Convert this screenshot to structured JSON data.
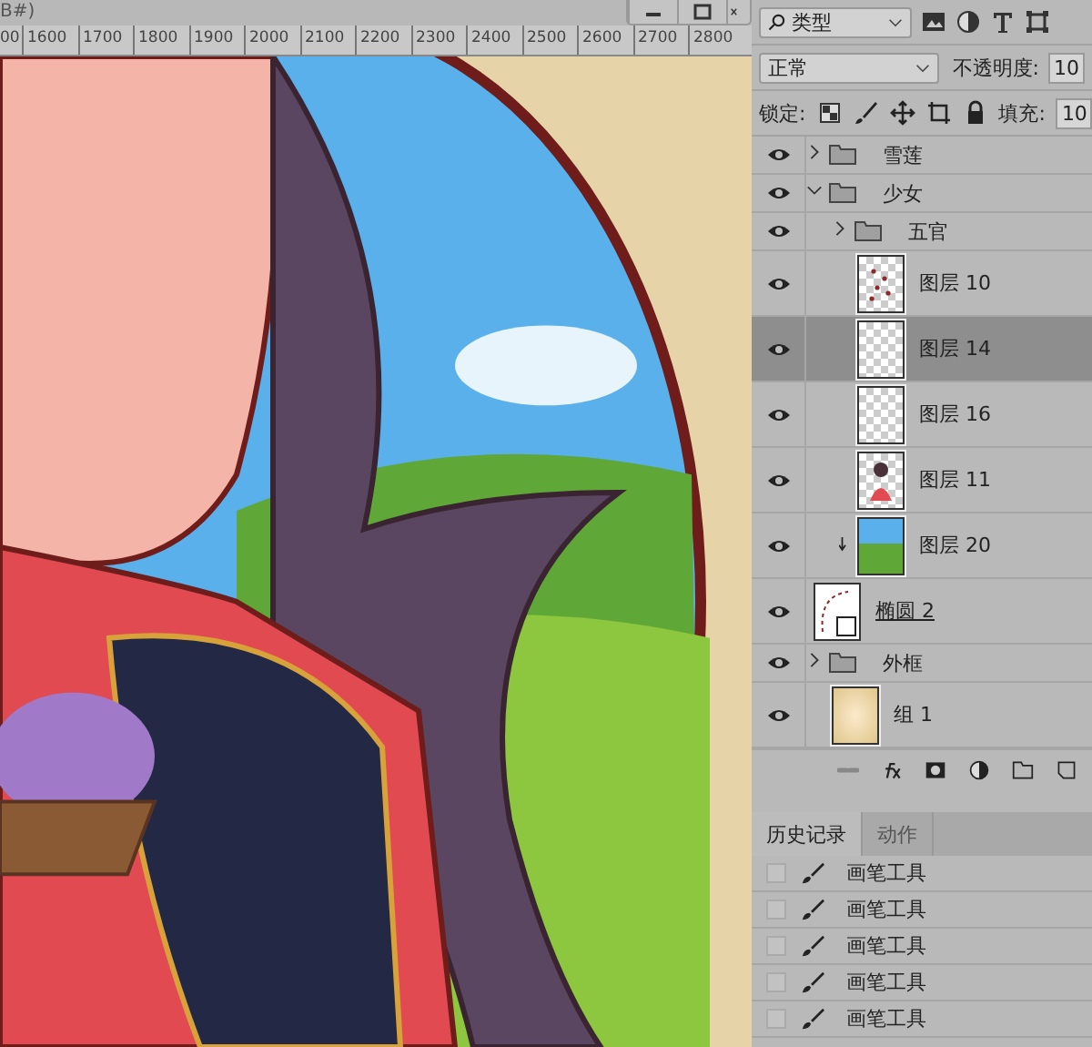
{
  "document": {
    "title_fragment": "B#)",
    "ruler_labels": [
      "00",
      "1600",
      "1700",
      "1800",
      "1900",
      "2000",
      "2100",
      "2200",
      "2300",
      "2400",
      "2500",
      "2600",
      "2700",
      "2800"
    ]
  },
  "layers_panel": {
    "filter": "类型",
    "blend_mode": "正常",
    "opacity_label": "不透明度:",
    "opacity_value": "10",
    "lock_label": "锁定:",
    "fill_label": "填充:",
    "fill_value": "10",
    "layers": [
      {
        "kind": "folder",
        "name": "雪莲",
        "visible": true,
        "selected": false,
        "expanded": false
      },
      {
        "kind": "folder",
        "name": "少女",
        "visible": true,
        "selected": false,
        "expanded": true,
        "children": [
          {
            "kind": "folder",
            "name": "五官",
            "visible": true,
            "selected": false,
            "expanded": false
          },
          {
            "kind": "scatter",
            "name": "图层 10",
            "visible": true,
            "selected": false,
            "clipped": false
          },
          {
            "kind": "blank",
            "name": "图层 14",
            "visible": true,
            "selected": true,
            "clipped": false
          },
          {
            "kind": "blank",
            "name": "图层 16",
            "visible": true,
            "selected": false,
            "clipped": false
          },
          {
            "kind": "figure",
            "name": "图层 11",
            "visible": true,
            "selected": false,
            "clipped": false
          },
          {
            "kind": "landscape",
            "name": "图层 20",
            "visible": true,
            "selected": false,
            "clipped": true
          }
        ]
      },
      {
        "kind": "shape",
        "name": "椭圆 2",
        "visible": true,
        "selected": false
      },
      {
        "kind": "folder",
        "name": "外框",
        "visible": true,
        "selected": false,
        "expanded": false
      },
      {
        "kind": "paper",
        "name": "组 1",
        "visible": true,
        "selected": false,
        "clipped": false
      }
    ]
  },
  "history_panel": {
    "tabs": [
      {
        "label": "历史记录",
        "selected": true
      },
      {
        "label": "动作",
        "selected": false
      }
    ],
    "items": [
      {
        "label": "画笔工具",
        "checked": false
      },
      {
        "label": "画笔工具",
        "checked": false
      },
      {
        "label": "画笔工具",
        "checked": false
      },
      {
        "label": "画笔工具",
        "checked": false
      },
      {
        "label": "画笔工具",
        "checked": false
      }
    ]
  }
}
